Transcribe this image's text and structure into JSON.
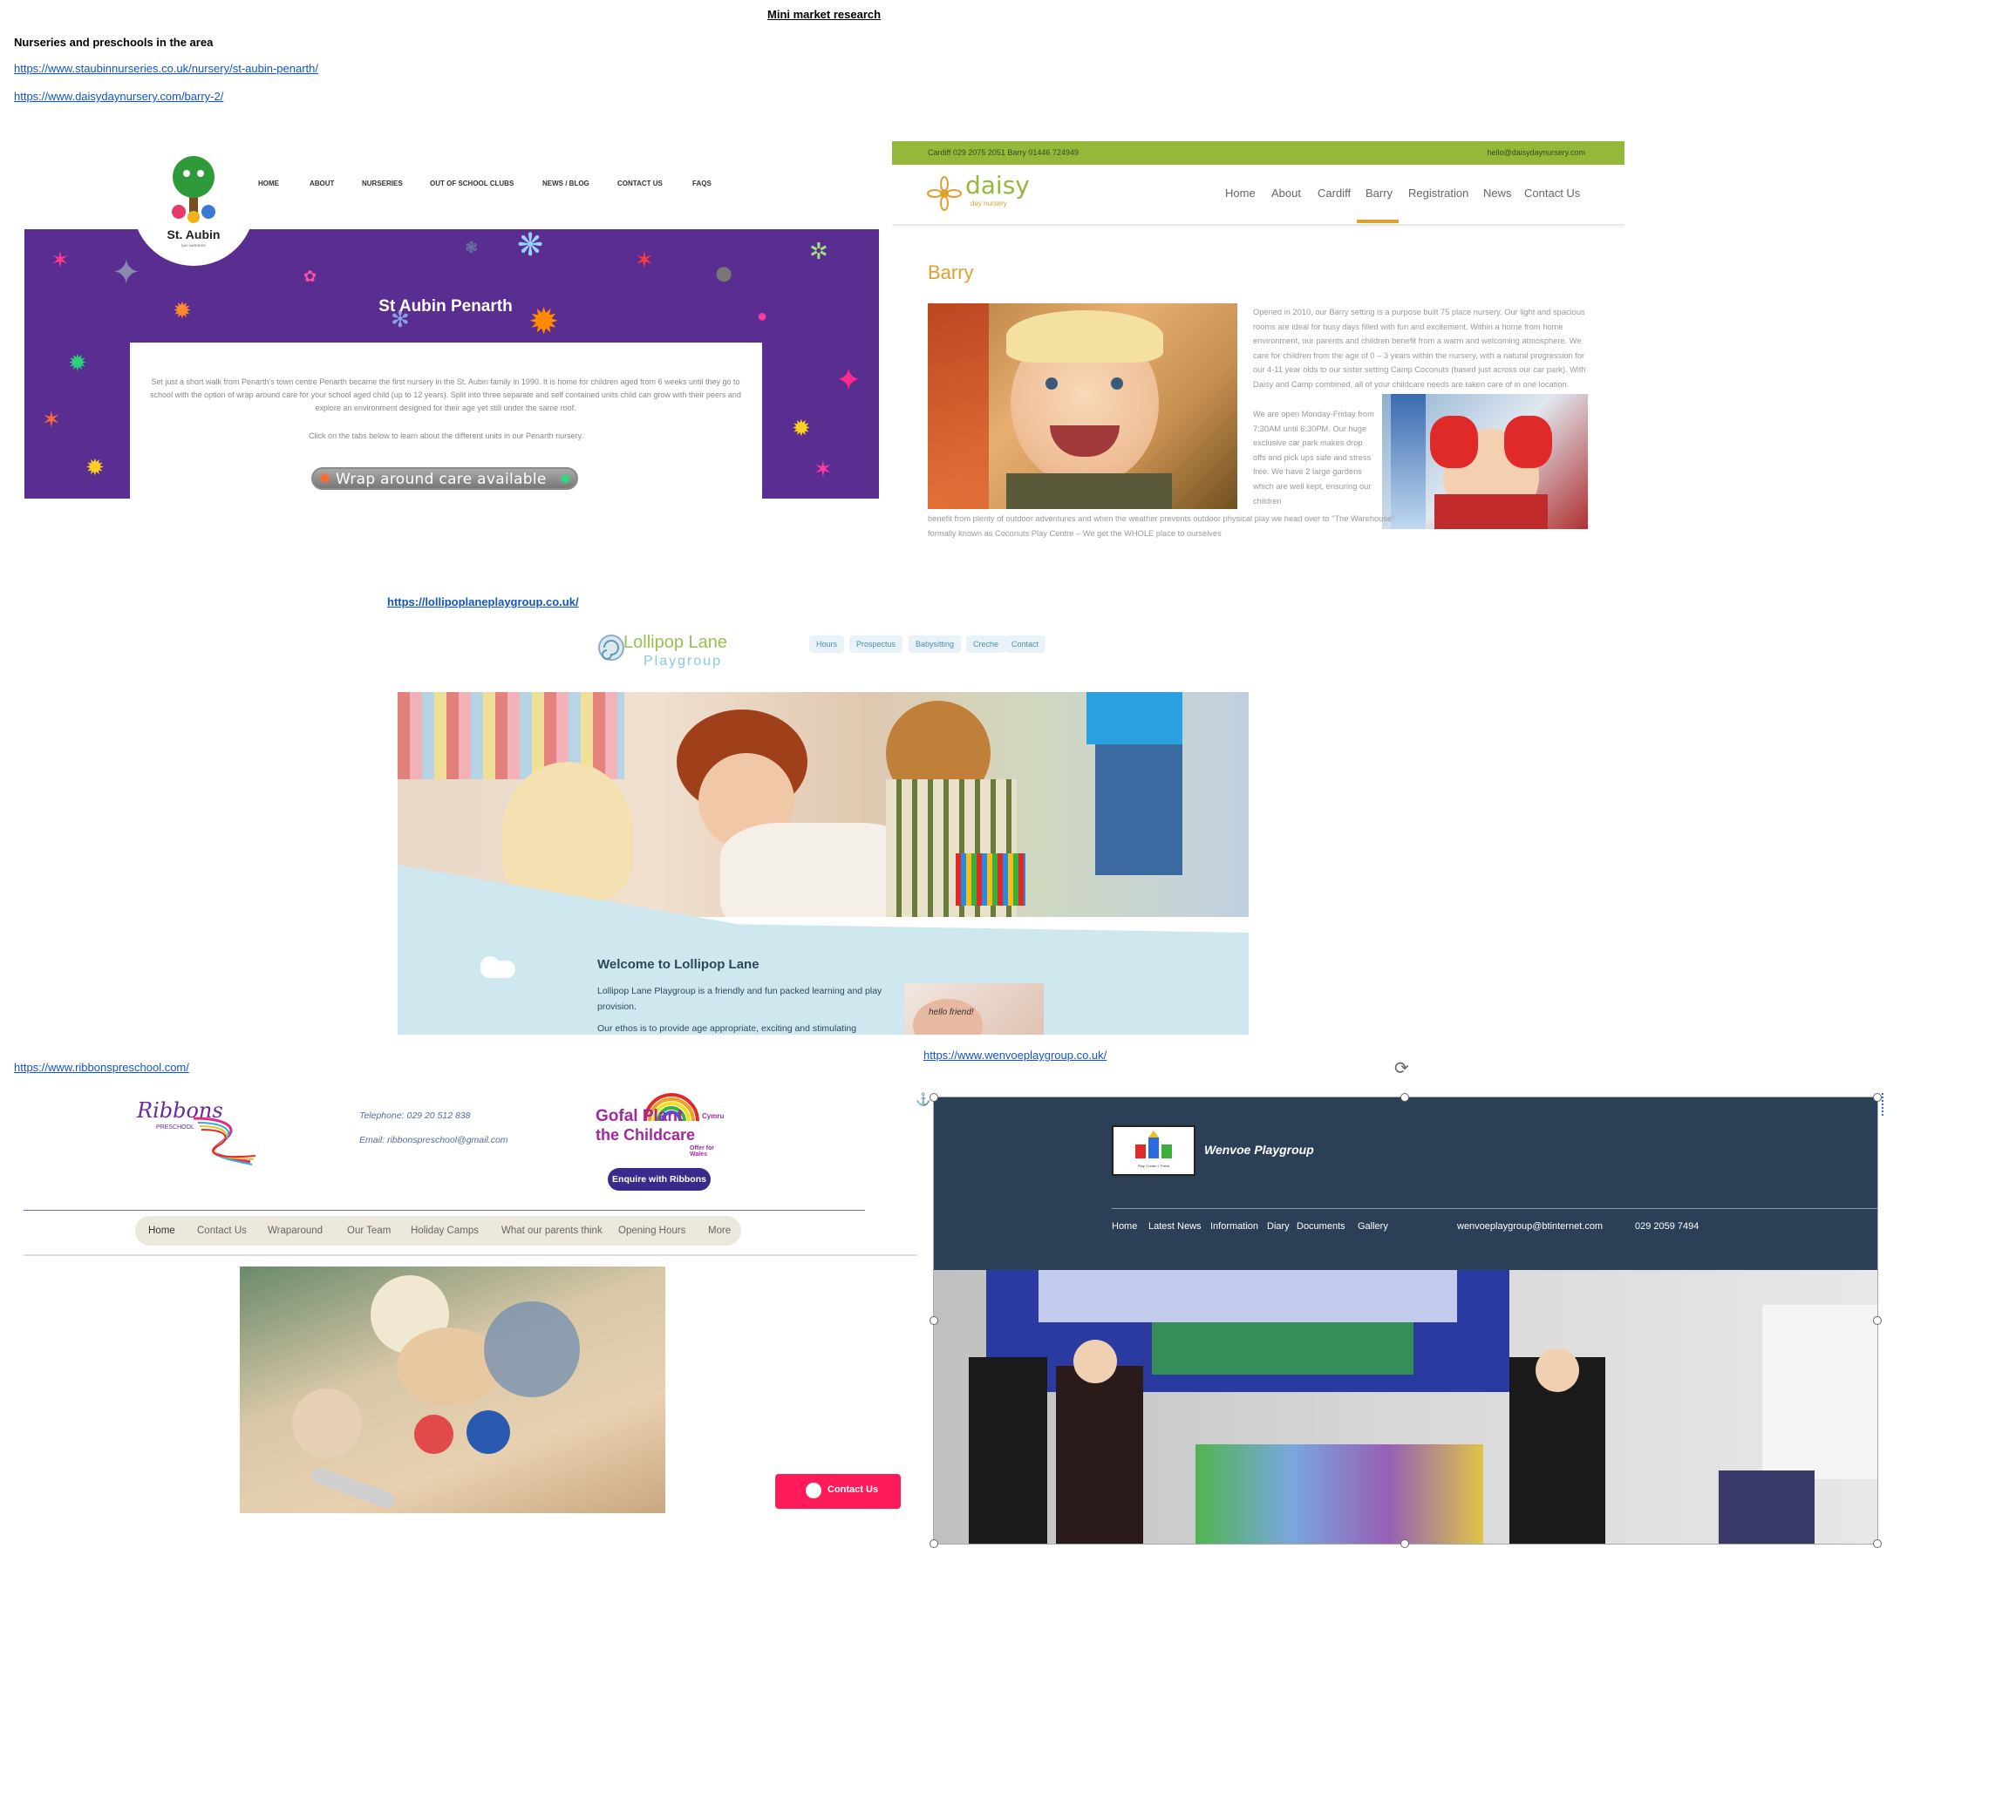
{
  "doc": {
    "title": "Mini market research",
    "heading": "Nurseries and preschools in the area",
    "links": {
      "st_aubin": "https://www.staubinnurseries.co.uk/nursery/st-aubin-penarth/",
      "daisy": "https://www.daisydaynursery.com/barry-2/",
      "lollipop": "https://lollipoplaneplaygroup.co.uk/",
      "ribbons": "https://www.ribbonspreschool.com/",
      "wenvoe": "https://www.wenvoeplaygroup.co.uk/"
    }
  },
  "st_aubin": {
    "logo_text": "St. Aubin",
    "logo_sub": "DAY NURSERY",
    "nav": [
      "HOME",
      "ABOUT",
      "NURSERIES",
      "OUT OF SCHOOL CLUBS",
      "NEWS / BLOG",
      "CONTACT US",
      "FAQS"
    ],
    "hero_title": "St Aubin Penarth",
    "body": "Set just a short walk from Penarth's town centre Penarth became the first nursery in the St. Aubin family in 1990. It is home for children aged from 6 weeks until they go to school with the option of wrap around care for your school aged child (up to 12 years). Split into three separate and self contained units child can grow with their peers and explore an environment designed for their age yet still under the same roof.",
    "tabs_note": "Click on the tabs below to learn about the different units in our Penarth nursery.",
    "badge": "Wrap around care available",
    "colors": {
      "hero": "#5a2d91"
    }
  },
  "daisy": {
    "topbar_left": "Cardiff 029 2075 2051  Barry 01446 724949",
    "topbar_right": "hello@daisydaynursery.com",
    "logo": "daisy",
    "logo_sub": "day nursery",
    "nav": [
      "Home",
      "About",
      "Cardiff",
      "Barry",
      "Registration",
      "News",
      "Contact Us"
    ],
    "active_nav": "Barry",
    "page_title": "Barry",
    "para_top": "Opened in 2010, our Barry setting is a purpose built 75 place nursery. Our light and spacious rooms are ideal for busy days filled with fun and excitement. Within a home from home environment, our parents and children benefit from a warm and welcoming atmosphere. We care for children from the age of 0 – 3 years within the nursery, with a natural progression for our 4-11 year olds to our sister setting Camp Coconuts (based just across our car park). With Daisy and Camp combined, all of your childcare needs are taken care of in one location.",
    "para_mid": "We are open Monday-Friday from 7:30AM until 6:30PM. Our huge exclusive car park makes drop offs and pick ups safe and stress free. We have 2 large gardens which are well kept, ensuring our children",
    "para_bottom": "benefit from plenty of outdoor adventures and when the weather prevents outdoor physical play we head over to \"The Warehouse\" formally known as Coconuts Play Centre – We get the WHOLE place to ourselves",
    "colors": {
      "topbar": "#94b83a",
      "accent": "#e0a030"
    }
  },
  "lollipop": {
    "logo_line1": "Lollipop Lane",
    "logo_line2": "Playgroup",
    "nav": [
      "Hours",
      "Prospectus",
      "Babysitting",
      "Creche",
      "Contact"
    ],
    "welcome": "Welcome to Lollipop Lane",
    "intro": "Lollipop Lane Playgroup is a friendly and fun packed learning and play provision.",
    "ethos": "Our ethos is to provide age appropriate, exciting and stimulating",
    "card_text": "hello friend!"
  },
  "ribbons": {
    "logo": "Ribbons",
    "logo_sub": "PRESCHOOL",
    "phone": "Telephone: 029 20 512 838",
    "email": "Email: ribbonspreschool@gmail.com",
    "badge_lines": [
      "Gofal Plant",
      "Cymru",
      "the Childcare",
      "Offer for Wales"
    ],
    "enquire": "Enquire with Ribbons",
    "nav": [
      "Home",
      "Contact Us",
      "Wraparound",
      "Our Team",
      "Holiday Camps",
      "What our parents think",
      "Opening Hours",
      "More"
    ],
    "active_nav": "Home",
    "contact_btn": "Contact Us",
    "colors": {
      "enquire": "#3a2a8c",
      "contact": "#ff1a5a"
    }
  },
  "wenvoe": {
    "site_name": "Wenvoe Playgroup",
    "logo_sub": "Play • Learn • Thrive",
    "nav": [
      "Home",
      "Latest News",
      "Information",
      "Diary",
      "Documents",
      "Gallery"
    ],
    "email": "wenvoeplaygroup@btinternet.com",
    "phone": "029 2059 7494",
    "colors": {
      "header": "#2b3f57"
    }
  }
}
